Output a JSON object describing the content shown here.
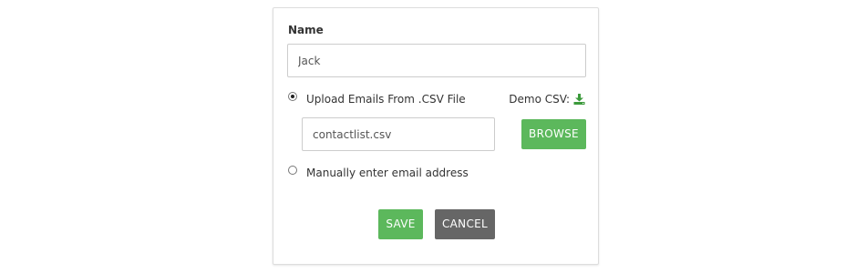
{
  "form": {
    "name_label": "Name",
    "name_value": "Jack",
    "upload_option": {
      "label": "Upload Emails From .CSV File",
      "selected": true
    },
    "demo_csv_label": "Demo CSV:",
    "demo_csv_icon": "download-icon",
    "file_value": "contactlist.csv",
    "browse_label": "BROWSE",
    "manual_option": {
      "label": "Manually enter email address",
      "selected": false
    },
    "save_label": "SAVE",
    "cancel_label": "CANCEL"
  },
  "colors": {
    "primary_green": "#5cb85c",
    "cancel_gray": "#666666",
    "icon_green": "#3c9a3c"
  }
}
